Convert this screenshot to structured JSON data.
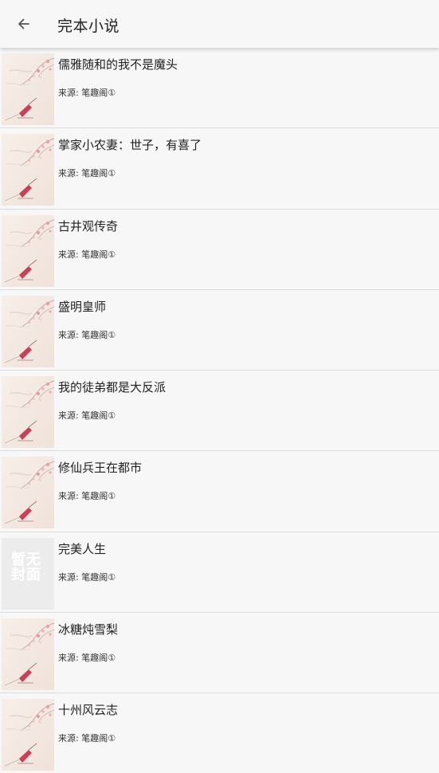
{
  "toolbar": {
    "title": "完本小说",
    "back_icon": "arrow-left-icon"
  },
  "source_prefix": "来源: ",
  "placeholder_text": "暂无封面",
  "books": [
    {
      "title": "儒雅随和的我不是魔头",
      "source": "笔趣阁①",
      "cover": "image"
    },
    {
      "title": "掌家小农妻：世子，有喜了",
      "source": "笔趣阁①",
      "cover": "image"
    },
    {
      "title": "古井观传奇",
      "source": "笔趣阁①",
      "cover": "image"
    },
    {
      "title": "盛明皇师",
      "source": "笔趣阁①",
      "cover": "image"
    },
    {
      "title": "我的徒弟都是大反派",
      "source": "笔趣阁①",
      "cover": "image"
    },
    {
      "title": "修仙兵王在都市",
      "source": "笔趣阁①",
      "cover": "image"
    },
    {
      "title": "完美人生",
      "source": "笔趣阁①",
      "cover": "placeholder"
    },
    {
      "title": "冰糖炖雪梨",
      "source": "笔趣阁①",
      "cover": "image"
    },
    {
      "title": "十州风云志",
      "source": "笔趣阁①",
      "cover": "image"
    }
  ]
}
